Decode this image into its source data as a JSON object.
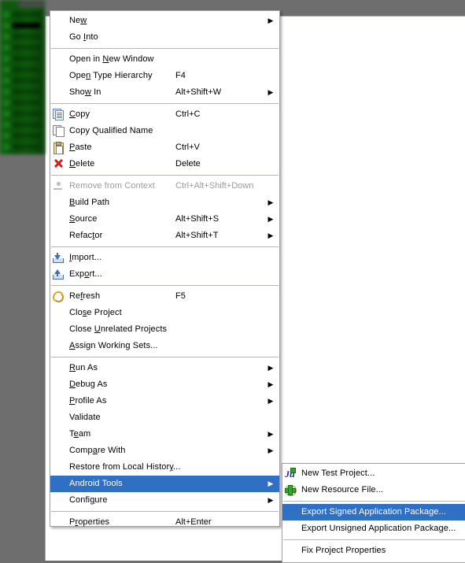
{
  "workbench": {
    "explorer_panel_name": "package-explorer-obscured",
    "explorer_rows": 14
  },
  "context_menu": {
    "name": "project-context-menu",
    "groups": [
      {
        "items": [
          {
            "icon": "",
            "label": "New",
            "mnemonic": "w",
            "accel": "",
            "arrow": true,
            "disabled": false,
            "selected": false
          },
          {
            "icon": "",
            "label": "Go Into",
            "mnemonic": "I",
            "accel": "",
            "arrow": false,
            "disabled": false,
            "selected": false
          }
        ]
      },
      {
        "items": [
          {
            "icon": "",
            "label": "Open in New Window",
            "mnemonic": "N",
            "accel": "",
            "arrow": false,
            "disabled": false,
            "selected": false
          },
          {
            "icon": "",
            "label": "Open Type Hierarchy",
            "mnemonic": "n",
            "accel": "F4",
            "arrow": false,
            "disabled": false,
            "selected": false
          },
          {
            "icon": "",
            "label": "Show In",
            "mnemonic": "w",
            "accel": "Alt+Shift+W",
            "arrow": true,
            "disabled": false,
            "selected": false
          }
        ]
      },
      {
        "items": [
          {
            "icon": "copy-icon",
            "label": "Copy",
            "mnemonic": "C",
            "accel": "Ctrl+C",
            "arrow": false,
            "disabled": false,
            "selected": false
          },
          {
            "icon": "copy-qualified-name-icon",
            "label": "Copy Qualified Name",
            "mnemonic": "",
            "accel": "",
            "arrow": false,
            "disabled": false,
            "selected": false
          },
          {
            "icon": "paste-icon",
            "label": "Paste",
            "mnemonic": "P",
            "accel": "Ctrl+V",
            "arrow": false,
            "disabled": false,
            "selected": false
          },
          {
            "icon": "delete-icon",
            "label": "Delete",
            "mnemonic": "D",
            "accel": "Delete",
            "arrow": false,
            "disabled": false,
            "selected": false
          }
        ]
      },
      {
        "items": [
          {
            "icon": "remove-from-context-icon",
            "label": "Remove from Context",
            "mnemonic": "",
            "accel": "Ctrl+Alt+Shift+Down",
            "arrow": false,
            "disabled": true,
            "selected": false
          },
          {
            "icon": "",
            "label": "Build Path",
            "mnemonic": "B",
            "accel": "",
            "arrow": true,
            "disabled": false,
            "selected": false
          },
          {
            "icon": "",
            "label": "Source",
            "mnemonic": "S",
            "accel": "Alt+Shift+S",
            "arrow": true,
            "disabled": false,
            "selected": false
          },
          {
            "icon": "",
            "label": "Refactor",
            "mnemonic": "t",
            "accel": "Alt+Shift+T",
            "arrow": true,
            "disabled": false,
            "selected": false
          }
        ]
      },
      {
        "items": [
          {
            "icon": "import-icon",
            "label": "Import...",
            "mnemonic": "I",
            "accel": "",
            "arrow": false,
            "disabled": false,
            "selected": false
          },
          {
            "icon": "export-icon",
            "label": "Export...",
            "mnemonic": "o",
            "accel": "",
            "arrow": false,
            "disabled": false,
            "selected": false
          }
        ]
      },
      {
        "items": [
          {
            "icon": "refresh-icon",
            "label": "Refresh",
            "mnemonic": "f",
            "accel": "F5",
            "arrow": false,
            "disabled": false,
            "selected": false
          },
          {
            "icon": "",
            "label": "Close Project",
            "mnemonic": "s",
            "accel": "",
            "arrow": false,
            "disabled": false,
            "selected": false
          },
          {
            "icon": "",
            "label": "Close Unrelated Projects",
            "mnemonic": "U",
            "accel": "",
            "arrow": false,
            "disabled": false,
            "selected": false
          },
          {
            "icon": "",
            "label": "Assign Working Sets...",
            "mnemonic": "A",
            "accel": "",
            "arrow": false,
            "disabled": false,
            "selected": false
          }
        ]
      },
      {
        "items": [
          {
            "icon": "",
            "label": "Run As",
            "mnemonic": "R",
            "accel": "",
            "arrow": true,
            "disabled": false,
            "selected": false
          },
          {
            "icon": "",
            "label": "Debug As",
            "mnemonic": "D",
            "accel": "",
            "arrow": true,
            "disabled": false,
            "selected": false
          },
          {
            "icon": "",
            "label": "Profile As",
            "mnemonic": "P",
            "accel": "",
            "arrow": true,
            "disabled": false,
            "selected": false
          },
          {
            "icon": "",
            "label": "Validate",
            "mnemonic": "",
            "accel": "",
            "arrow": false,
            "disabled": false,
            "selected": false
          },
          {
            "icon": "",
            "label": "Team",
            "mnemonic": "e",
            "accel": "",
            "arrow": true,
            "disabled": false,
            "selected": false
          },
          {
            "icon": "",
            "label": "Compare With",
            "mnemonic": "a",
            "accel": "",
            "arrow": true,
            "disabled": false,
            "selected": false
          },
          {
            "icon": "",
            "label": "Restore from Local History...",
            "mnemonic": "y",
            "accel": "",
            "arrow": false,
            "disabled": false,
            "selected": false
          },
          {
            "icon": "",
            "label": "Android Tools",
            "mnemonic": "",
            "accel": "",
            "arrow": true,
            "disabled": false,
            "selected": true
          },
          {
            "icon": "",
            "label": "Configure",
            "mnemonic": "g",
            "accel": "",
            "arrow": true,
            "disabled": false,
            "selected": false
          }
        ]
      },
      {
        "items": [
          {
            "icon": "",
            "label": "Properties",
            "mnemonic": "r",
            "accel": "Alt+Enter",
            "arrow": false,
            "disabled": false,
            "selected": false
          }
        ]
      }
    ]
  },
  "submenu": {
    "name": "android-tools-submenu",
    "groups": [
      {
        "items": [
          {
            "icon": "junit-icon",
            "label": "New Test Project...",
            "accel": "",
            "arrow": false,
            "disabled": false,
            "selected": false
          },
          {
            "icon": "new-resource-file-icon",
            "label": "New Resource File...",
            "accel": "",
            "arrow": false,
            "disabled": false,
            "selected": false
          }
        ]
      },
      {
        "items": [
          {
            "icon": "",
            "label": "Export Signed Application Package...",
            "accel": "",
            "arrow": false,
            "disabled": false,
            "selected": true
          },
          {
            "icon": "",
            "label": "Export Unsigned Application Package...",
            "accel": "",
            "arrow": false,
            "disabled": false,
            "selected": false
          }
        ]
      },
      {
        "items": [
          {
            "icon": "",
            "label": "Fix Project Properties",
            "accel": "",
            "arrow": false,
            "disabled": false,
            "selected": false
          }
        ]
      }
    ]
  },
  "colors": {
    "menu_background": "#ffffff",
    "menu_border": "#a0a0a0",
    "highlight": "#2f6fc4",
    "highlight_text": "#ffffff",
    "disabled_text": "#9c9c9c",
    "desktop": "#6e6e6e",
    "separator": "#b6b6ae",
    "explorer_green": "#0c5a0c"
  }
}
